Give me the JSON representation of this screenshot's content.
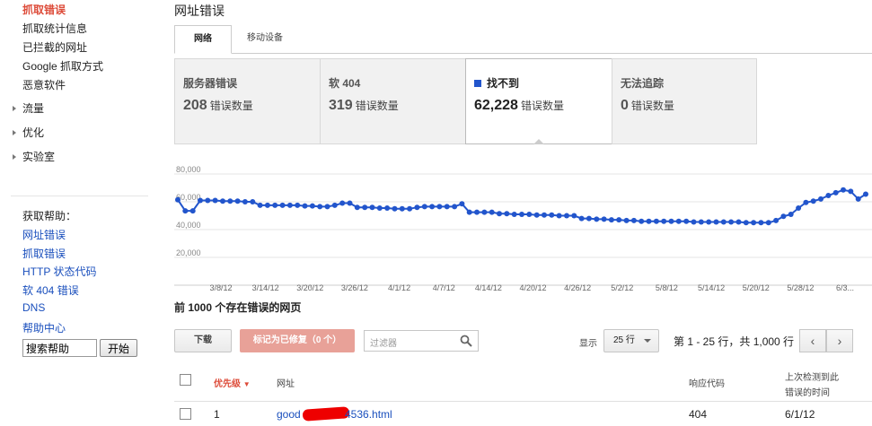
{
  "sidebar": {
    "items": [
      {
        "label": "抓取错误",
        "active": true
      },
      {
        "label": "抓取统计信息"
      },
      {
        "label": "已拦截的网址"
      },
      {
        "label": "Google 抓取方式"
      },
      {
        "label": "恶意软件"
      }
    ],
    "groups": [
      "流量",
      "优化",
      "实验室"
    ],
    "help_title": "获取帮助：",
    "help_links": [
      "网址错误",
      "抓取错误",
      "HTTP 状态代码",
      "软 404 错误",
      "DNS",
      "帮助中心"
    ],
    "search_value": "搜索帮助",
    "search_button": "开始"
  },
  "page_title": "网址错误",
  "tabs": [
    {
      "label": "网络",
      "active": true
    },
    {
      "label": "移动设备"
    }
  ],
  "summary": [
    {
      "title": "服务器错误",
      "count": "208",
      "unit": "错误数量"
    },
    {
      "title": "软 404",
      "count": "319",
      "unit": "错误数量"
    },
    {
      "title": "找不到",
      "count": "62,228",
      "unit": "错误数量",
      "selected": true,
      "color": "#2255cc"
    },
    {
      "title": "无法追踪",
      "count": "0",
      "unit": "错误数量"
    }
  ],
  "chart_data": {
    "type": "line",
    "series": [
      {
        "name": "找不到",
        "color": "#2255cc",
        "values": [
          61500,
          53500,
          53500,
          61000,
          61000,
          61000,
          60500,
          60500,
          60500,
          60000,
          60000,
          57500,
          57500,
          57500,
          57500,
          57500,
          57500,
          57000,
          57000,
          56500,
          56500,
          57500,
          59000,
          59000,
          56000,
          56000,
          56000,
          55500,
          55500,
          55000,
          55000,
          55000,
          56000,
          56500,
          56500,
          56500,
          56500,
          56500,
          58500,
          52500,
          52500,
          52500,
          52500,
          51500,
          51500,
          51000,
          51000,
          51000,
          50500,
          50500,
          50500,
          50000,
          50000,
          50000,
          48000,
          48000,
          47500,
          47500,
          47000,
          47000,
          46500,
          46500,
          46000,
          46000,
          46000,
          46000,
          46000,
          46000,
          46000,
          45500,
          45500,
          45500,
          45500,
          45500,
          45500,
          45500,
          45000,
          45000,
          45000,
          45000,
          46500,
          49500,
          51000,
          55500,
          59500,
          60500,
          62000,
          64500,
          66500,
          68500,
          67500,
          62000,
          65500
        ]
      }
    ],
    "x_tick_labels": [
      "3/8/12",
      "3/14/12",
      "3/20/12",
      "3/26/12",
      "4/1/12",
      "4/7/12",
      "4/14/12",
      "4/20/12",
      "4/26/12",
      "5/2/12",
      "5/8/12",
      "5/14/12",
      "5/20/12",
      "5/28/12",
      "6/3..."
    ],
    "y_tick_labels": [
      "80,000",
      "60,000",
      "40,000",
      "20,000"
    ],
    "y_ticks": [
      80000,
      60000,
      40000,
      20000
    ],
    "ylim": [
      0,
      80000
    ],
    "grid": true
  },
  "list_heading": "前 1000 个存在错误的网页",
  "toolbar": {
    "download": "下载",
    "mark_fixed": "标记为已修复（0 个）",
    "filter_placeholder": "过滤器",
    "show_label": "显示",
    "rows_value": "25 行",
    "paging_text": "第 1 - 25 行，共 1,000 行",
    "prev": "‹",
    "next": "›"
  },
  "table": {
    "headers": {
      "priority": "优先级",
      "url": "网址",
      "response_code": "响应代码",
      "last_detected_line1": "上次检测到此",
      "last_detected_line2": "错误的时间"
    },
    "rows": [
      {
        "priority": "1",
        "url": "good",
        "url_tail": "4536.html",
        "code": "404",
        "date": "6/1/12"
      }
    ]
  }
}
